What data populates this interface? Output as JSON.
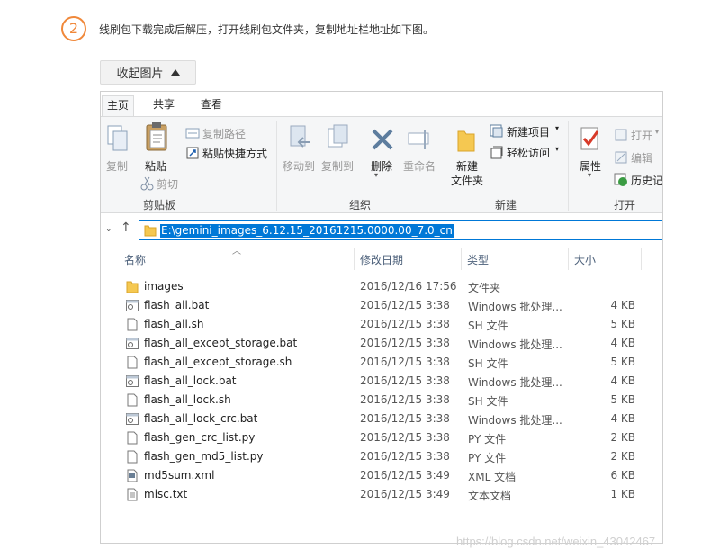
{
  "step": {
    "number": "2",
    "text": "线刷包下载完成后解压，打开线刷包文件夹，复制地址栏地址如下图。"
  },
  "collapse_button": {
    "label": "收起图片"
  },
  "ribbon": {
    "tabs": [
      "主页",
      "共享",
      "查看"
    ],
    "clipboard": {
      "copy": "复制",
      "paste": "粘贴",
      "copy_path": "复制路径",
      "paste_shortcut": "粘贴快捷方式",
      "cut": "剪切",
      "group": "剪贴板"
    },
    "organize": {
      "move_to": "移动到",
      "copy_to": "复制到",
      "delete": "删除",
      "rename": "重命名",
      "group": "组织"
    },
    "new": {
      "new_folder_l1": "新建",
      "new_folder_l2": "文件夹",
      "new_item": "新建项目",
      "easy_access": "轻松访问",
      "group": "新建"
    },
    "open": {
      "properties": "属性",
      "open": "打开",
      "edit": "编辑",
      "history": "历史记",
      "group": "打开"
    }
  },
  "address_bar": {
    "path": "E:\\gemini_images_6.12.15_20161215.0000.00_7.0_cn"
  },
  "columns": {
    "name": "名称",
    "date": "修改日期",
    "type": "类型",
    "size": "大小"
  },
  "files": [
    {
      "name": "images",
      "date": "2016/12/16 17:56",
      "type": "文件夹",
      "size": "",
      "icon": "folder"
    },
    {
      "name": "flash_all.bat",
      "date": "2016/12/15 3:38",
      "type": "Windows 批处理...",
      "size": "4 KB",
      "icon": "bat"
    },
    {
      "name": "flash_all.sh",
      "date": "2016/12/15 3:38",
      "type": "SH 文件",
      "size": "5 KB",
      "icon": "file"
    },
    {
      "name": "flash_all_except_storage.bat",
      "date": "2016/12/15 3:38",
      "type": "Windows 批处理...",
      "size": "4 KB",
      "icon": "bat"
    },
    {
      "name": "flash_all_except_storage.sh",
      "date": "2016/12/15 3:38",
      "type": "SH 文件",
      "size": "5 KB",
      "icon": "file"
    },
    {
      "name": "flash_all_lock.bat",
      "date": "2016/12/15 3:38",
      "type": "Windows 批处理...",
      "size": "4 KB",
      "icon": "bat"
    },
    {
      "name": "flash_all_lock.sh",
      "date": "2016/12/15 3:38",
      "type": "SH 文件",
      "size": "5 KB",
      "icon": "file"
    },
    {
      "name": "flash_all_lock_crc.bat",
      "date": "2016/12/15 3:38",
      "type": "Windows 批处理...",
      "size": "4 KB",
      "icon": "bat"
    },
    {
      "name": "flash_gen_crc_list.py",
      "date": "2016/12/15 3:38",
      "type": "PY 文件",
      "size": "2 KB",
      "icon": "file"
    },
    {
      "name": "flash_gen_md5_list.py",
      "date": "2016/12/15 3:38",
      "type": "PY 文件",
      "size": "2 KB",
      "icon": "file"
    },
    {
      "name": "md5sum.xml",
      "date": "2016/12/15 3:49",
      "type": "XML 文档",
      "size": "6 KB",
      "icon": "xml"
    },
    {
      "name": "misc.txt",
      "date": "2016/12/15 3:49",
      "type": "文本文档",
      "size": "1 KB",
      "icon": "txt"
    }
  ],
  "watermark": "https://blog.csdn.net/weixin_43042467"
}
